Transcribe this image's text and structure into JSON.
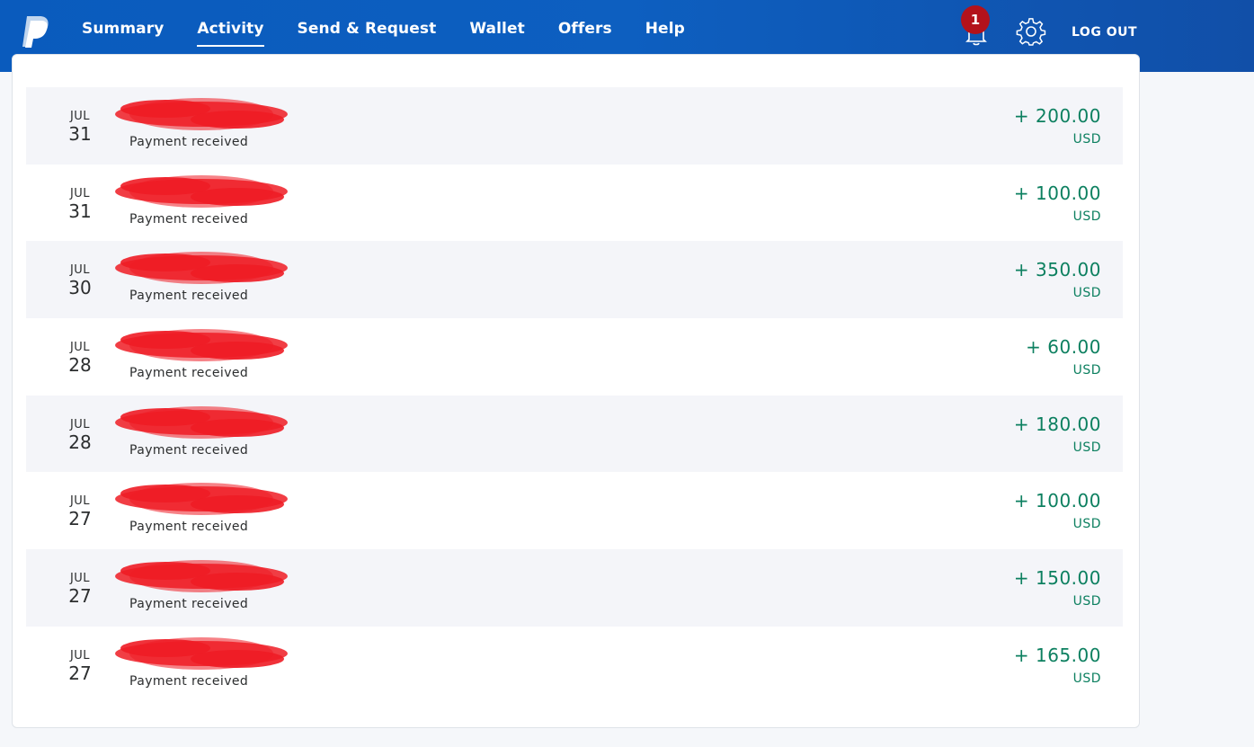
{
  "brand": {
    "logo_icon": "paypal-logo-icon",
    "header_color": "#0a5bbd"
  },
  "nav": {
    "items": [
      {
        "label": "Summary",
        "active": false
      },
      {
        "label": "Activity",
        "active": true
      },
      {
        "label": "Send & Request",
        "active": false
      },
      {
        "label": "Wallet",
        "active": false
      },
      {
        "label": "Offers",
        "active": false
      },
      {
        "label": "Help",
        "active": false
      }
    ]
  },
  "header": {
    "notification_icon": "bell-icon",
    "notification_count": "1",
    "settings_icon": "gear-icon",
    "logout_label": "LOG OUT"
  },
  "colors": {
    "amount_green": "#0d8060",
    "badge_red": "#b3121b",
    "redaction_red": "#ee1c25"
  },
  "transactions": [
    {
      "month": "JUL",
      "day": "31",
      "description": "Payment received",
      "amount": "+ 200.00",
      "currency": "USD"
    },
    {
      "month": "JUL",
      "day": "31",
      "description": "Payment received",
      "amount": "+ 100.00",
      "currency": "USD"
    },
    {
      "month": "JUL",
      "day": "30",
      "description": "Payment received",
      "amount": "+ 350.00",
      "currency": "USD"
    },
    {
      "month": "JUL",
      "day": "28",
      "description": "Payment received",
      "amount": "+ 60.00",
      "currency": "USD"
    },
    {
      "month": "JUL",
      "day": "28",
      "description": "Payment received",
      "amount": "+ 180.00",
      "currency": "USD"
    },
    {
      "month": "JUL",
      "day": "27",
      "description": "Payment received",
      "amount": "+ 100.00",
      "currency": "USD"
    },
    {
      "month": "JUL",
      "day": "27",
      "description": "Payment received",
      "amount": "+ 150.00",
      "currency": "USD"
    },
    {
      "month": "JUL",
      "day": "27",
      "description": "Payment received",
      "amount": "+ 165.00",
      "currency": "USD"
    }
  ]
}
